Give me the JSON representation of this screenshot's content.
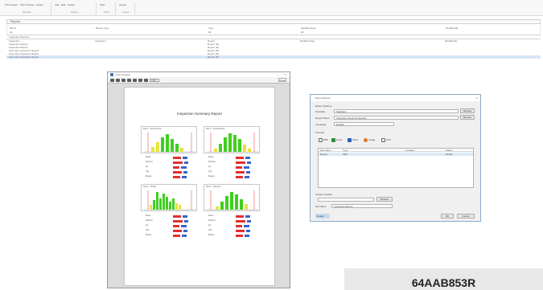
{
  "ribbon": {
    "groups": [
      {
        "label": "Reports",
        "buttons": [
          "Print Report",
          "Print Preview",
          "Export"
        ]
      },
      {
        "label": "Actions",
        "buttons": [
          "Add",
          "Edit",
          "Delete"
        ]
      },
      {
        "label": "Filter",
        "buttons": [
          "Filter"
        ]
      },
      {
        "label": "Layout",
        "buttons": [
          "Layout"
        ]
      }
    ]
  },
  "list_pane": {
    "header": "Reports",
    "columns": [
      "Name",
      "Report Type",
      "Type",
      "Modified Date",
      "Modified By"
    ],
    "top_row": [
      "All",
      "",
      "All",
      "All",
      ""
    ],
    "group_header": "Inspection Reports",
    "rows": [
      {
        "name": "Inspection",
        "report_type": "Inspection",
        "type": "Report",
        "modified": "Modified Date",
        "by": "Modified By",
        "selected": false
      },
      {
        "name": "Inspection Report",
        "report_type": "",
        "type": "Report (R)",
        "modified": "",
        "by": "",
        "selected": false
      },
      {
        "name": "Inspection Report",
        "report_type": "",
        "type": "Report (R)",
        "modified": "",
        "by": "",
        "selected": false
      },
      {
        "name": "Summary Inspection Report",
        "report_type": "",
        "type": "Report (R)",
        "modified": "",
        "by": "",
        "selected": false
      },
      {
        "name": "Summary Inspection Report",
        "report_type": "",
        "type": "Report (R)",
        "modified": "",
        "by": "",
        "selected": false
      },
      {
        "name": "Summary Inspection Report",
        "report_type": "",
        "type": "Report (R)",
        "modified": "",
        "by": "",
        "selected": true
      }
    ]
  },
  "print_preview": {
    "window_title": "Print Preview",
    "zoom": "100%",
    "close_label": "Close",
    "page_title": "Inspection Summary Report",
    "charts": [
      {
        "title": "Part 1 - Dimension A"
      },
      {
        "title": "Part 1 - Dimension B"
      },
      {
        "title": "Part 2 - Profile"
      },
      {
        "title": "Part 2 - Flatness"
      }
    ],
    "stats": [
      "Mean",
      "Std Dev",
      "Cp",
      "Cpk",
      "Range"
    ]
  },
  "dialog": {
    "title": "Export Report",
    "section_label": "Report Options",
    "fields": [
      {
        "label": "Template",
        "value": "Standard"
      },
      {
        "label": "Report Name",
        "value": "Inspection Summary Report"
      },
      {
        "label": "Language",
        "value": "English"
      }
    ],
    "browse_label": "Browse",
    "formats_label": "Formats",
    "formats": [
      "PDF",
      "Excel",
      "Word",
      "Image",
      "CSV"
    ],
    "list_columns": [
      "File Name",
      "Type",
      "Location",
      "Status"
    ],
    "list_rows": [
      [
        "Report",
        "PDF",
        "",
        "Ready"
      ]
    ],
    "output_label": "Output Location",
    "output_field": "",
    "output_btn": "Browse",
    "filename_label": "File Name",
    "filename_value": "Inspection Report",
    "status": "Ready",
    "ok_label": "OK",
    "cancel_label": "Cancel"
  },
  "footer_code": "64AAB853R",
  "colors": {
    "chart_green": "#3fcf1f",
    "chart_yellow": "#e8e23a",
    "chart_red": "#e03030",
    "chart_blue": "#3a62c9",
    "selection": "#d7e6f7"
  }
}
